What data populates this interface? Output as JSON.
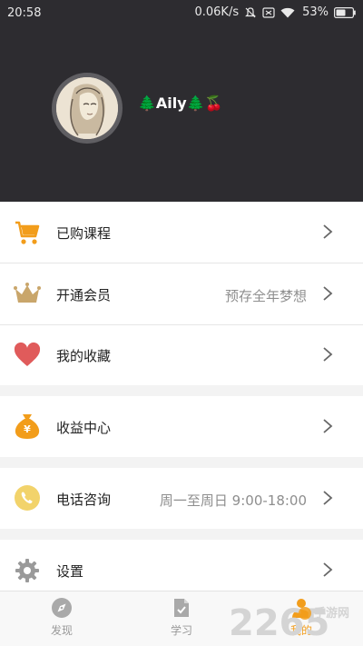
{
  "status_bar": {
    "time": "20:58",
    "network_speed": "0.06K/s",
    "battery": "53%"
  },
  "profile": {
    "username": "🌲Aily🌲🍒"
  },
  "menu": [
    {
      "label": "已购课程",
      "sub": "",
      "icon": "cart-icon"
    },
    {
      "label": "开通会员",
      "sub": "预存全年梦想",
      "icon": "crown-icon"
    },
    {
      "label": "我的收藏",
      "sub": "",
      "icon": "heart-icon"
    },
    {
      "label": "收益中心",
      "sub": "",
      "icon": "money-bag-icon"
    },
    {
      "label": "电话咨询",
      "sub": "周一至周日 9:00-18:00",
      "icon": "phone-icon"
    },
    {
      "label": "设置",
      "sub": "",
      "icon": "gear-icon"
    }
  ],
  "tabs": [
    {
      "label": "发现",
      "icon": "compass-icon",
      "active": false
    },
    {
      "label": "学习",
      "icon": "document-check-icon",
      "active": false
    },
    {
      "label": "我的",
      "icon": "user-icon",
      "active": true
    }
  ],
  "watermark": {
    "number": "2265",
    "text": "手游网"
  },
  "colors": {
    "header_bg": "#2d2c30",
    "accent_orange": "#f29d1b",
    "heart_red": "#e05b5b",
    "crown_gold": "#c9a66b"
  }
}
